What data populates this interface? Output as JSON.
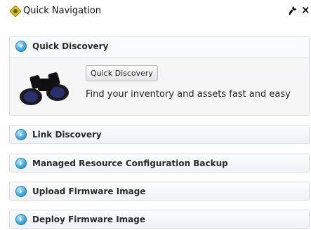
{
  "header": {
    "title": "Quick Navigation"
  },
  "panels": [
    {
      "title": "Quick Discovery",
      "button_label": "Quick Discovery",
      "description": "Find your inventory and assets fast and easy"
    },
    {
      "title": "Link Discovery"
    },
    {
      "title": "Managed Resource Configuration Backup"
    },
    {
      "title": "Upload Firmware Image"
    },
    {
      "title": "Deploy Firmware Image"
    }
  ],
  "colors": {
    "accent": "#3fa7df",
    "panel_border": "#d7dde6"
  }
}
